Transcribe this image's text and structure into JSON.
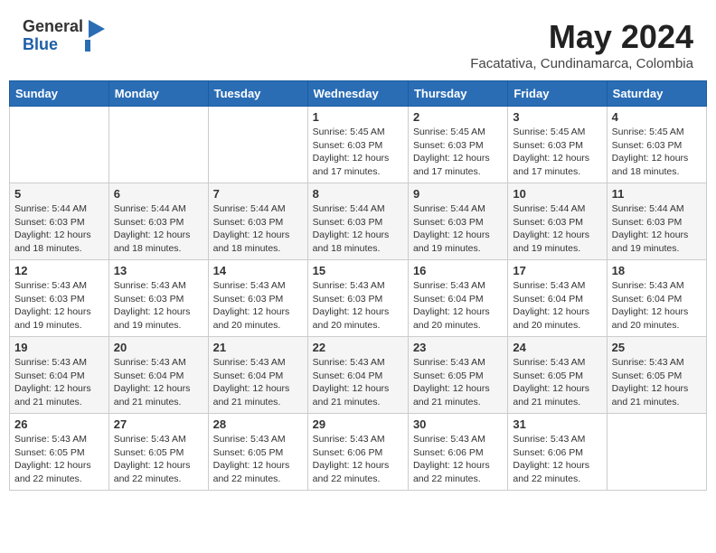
{
  "header": {
    "logo_general": "General",
    "logo_blue": "Blue",
    "month_year": "May 2024",
    "location": "Facatativa, Cundinamarca, Colombia"
  },
  "calendar": {
    "headers": [
      "Sunday",
      "Monday",
      "Tuesday",
      "Wednesday",
      "Thursday",
      "Friday",
      "Saturday"
    ],
    "weeks": [
      [
        {
          "day": "",
          "info": ""
        },
        {
          "day": "",
          "info": ""
        },
        {
          "day": "",
          "info": ""
        },
        {
          "day": "1",
          "info": "Sunrise: 5:45 AM\nSunset: 6:03 PM\nDaylight: 12 hours\nand 17 minutes."
        },
        {
          "day": "2",
          "info": "Sunrise: 5:45 AM\nSunset: 6:03 PM\nDaylight: 12 hours\nand 17 minutes."
        },
        {
          "day": "3",
          "info": "Sunrise: 5:45 AM\nSunset: 6:03 PM\nDaylight: 12 hours\nand 17 minutes."
        },
        {
          "day": "4",
          "info": "Sunrise: 5:45 AM\nSunset: 6:03 PM\nDaylight: 12 hours\nand 18 minutes."
        }
      ],
      [
        {
          "day": "5",
          "info": "Sunrise: 5:44 AM\nSunset: 6:03 PM\nDaylight: 12 hours\nand 18 minutes."
        },
        {
          "day": "6",
          "info": "Sunrise: 5:44 AM\nSunset: 6:03 PM\nDaylight: 12 hours\nand 18 minutes."
        },
        {
          "day": "7",
          "info": "Sunrise: 5:44 AM\nSunset: 6:03 PM\nDaylight: 12 hours\nand 18 minutes."
        },
        {
          "day": "8",
          "info": "Sunrise: 5:44 AM\nSunset: 6:03 PM\nDaylight: 12 hours\nand 18 minutes."
        },
        {
          "day": "9",
          "info": "Sunrise: 5:44 AM\nSunset: 6:03 PM\nDaylight: 12 hours\nand 19 minutes."
        },
        {
          "day": "10",
          "info": "Sunrise: 5:44 AM\nSunset: 6:03 PM\nDaylight: 12 hours\nand 19 minutes."
        },
        {
          "day": "11",
          "info": "Sunrise: 5:44 AM\nSunset: 6:03 PM\nDaylight: 12 hours\nand 19 minutes."
        }
      ],
      [
        {
          "day": "12",
          "info": "Sunrise: 5:43 AM\nSunset: 6:03 PM\nDaylight: 12 hours\nand 19 minutes."
        },
        {
          "day": "13",
          "info": "Sunrise: 5:43 AM\nSunset: 6:03 PM\nDaylight: 12 hours\nand 19 minutes."
        },
        {
          "day": "14",
          "info": "Sunrise: 5:43 AM\nSunset: 6:03 PM\nDaylight: 12 hours\nand 20 minutes."
        },
        {
          "day": "15",
          "info": "Sunrise: 5:43 AM\nSunset: 6:03 PM\nDaylight: 12 hours\nand 20 minutes."
        },
        {
          "day": "16",
          "info": "Sunrise: 5:43 AM\nSunset: 6:04 PM\nDaylight: 12 hours\nand 20 minutes."
        },
        {
          "day": "17",
          "info": "Sunrise: 5:43 AM\nSunset: 6:04 PM\nDaylight: 12 hours\nand 20 minutes."
        },
        {
          "day": "18",
          "info": "Sunrise: 5:43 AM\nSunset: 6:04 PM\nDaylight: 12 hours\nand 20 minutes."
        }
      ],
      [
        {
          "day": "19",
          "info": "Sunrise: 5:43 AM\nSunset: 6:04 PM\nDaylight: 12 hours\nand 21 minutes."
        },
        {
          "day": "20",
          "info": "Sunrise: 5:43 AM\nSunset: 6:04 PM\nDaylight: 12 hours\nand 21 minutes."
        },
        {
          "day": "21",
          "info": "Sunrise: 5:43 AM\nSunset: 6:04 PM\nDaylight: 12 hours\nand 21 minutes."
        },
        {
          "day": "22",
          "info": "Sunrise: 5:43 AM\nSunset: 6:04 PM\nDaylight: 12 hours\nand 21 minutes."
        },
        {
          "day": "23",
          "info": "Sunrise: 5:43 AM\nSunset: 6:05 PM\nDaylight: 12 hours\nand 21 minutes."
        },
        {
          "day": "24",
          "info": "Sunrise: 5:43 AM\nSunset: 6:05 PM\nDaylight: 12 hours\nand 21 minutes."
        },
        {
          "day": "25",
          "info": "Sunrise: 5:43 AM\nSunset: 6:05 PM\nDaylight: 12 hours\nand 21 minutes."
        }
      ],
      [
        {
          "day": "26",
          "info": "Sunrise: 5:43 AM\nSunset: 6:05 PM\nDaylight: 12 hours\nand 22 minutes."
        },
        {
          "day": "27",
          "info": "Sunrise: 5:43 AM\nSunset: 6:05 PM\nDaylight: 12 hours\nand 22 minutes."
        },
        {
          "day": "28",
          "info": "Sunrise: 5:43 AM\nSunset: 6:05 PM\nDaylight: 12 hours\nand 22 minutes."
        },
        {
          "day": "29",
          "info": "Sunrise: 5:43 AM\nSunset: 6:06 PM\nDaylight: 12 hours\nand 22 minutes."
        },
        {
          "day": "30",
          "info": "Sunrise: 5:43 AM\nSunset: 6:06 PM\nDaylight: 12 hours\nand 22 minutes."
        },
        {
          "day": "31",
          "info": "Sunrise: 5:43 AM\nSunset: 6:06 PM\nDaylight: 12 hours\nand 22 minutes."
        },
        {
          "day": "",
          "info": ""
        }
      ]
    ]
  }
}
